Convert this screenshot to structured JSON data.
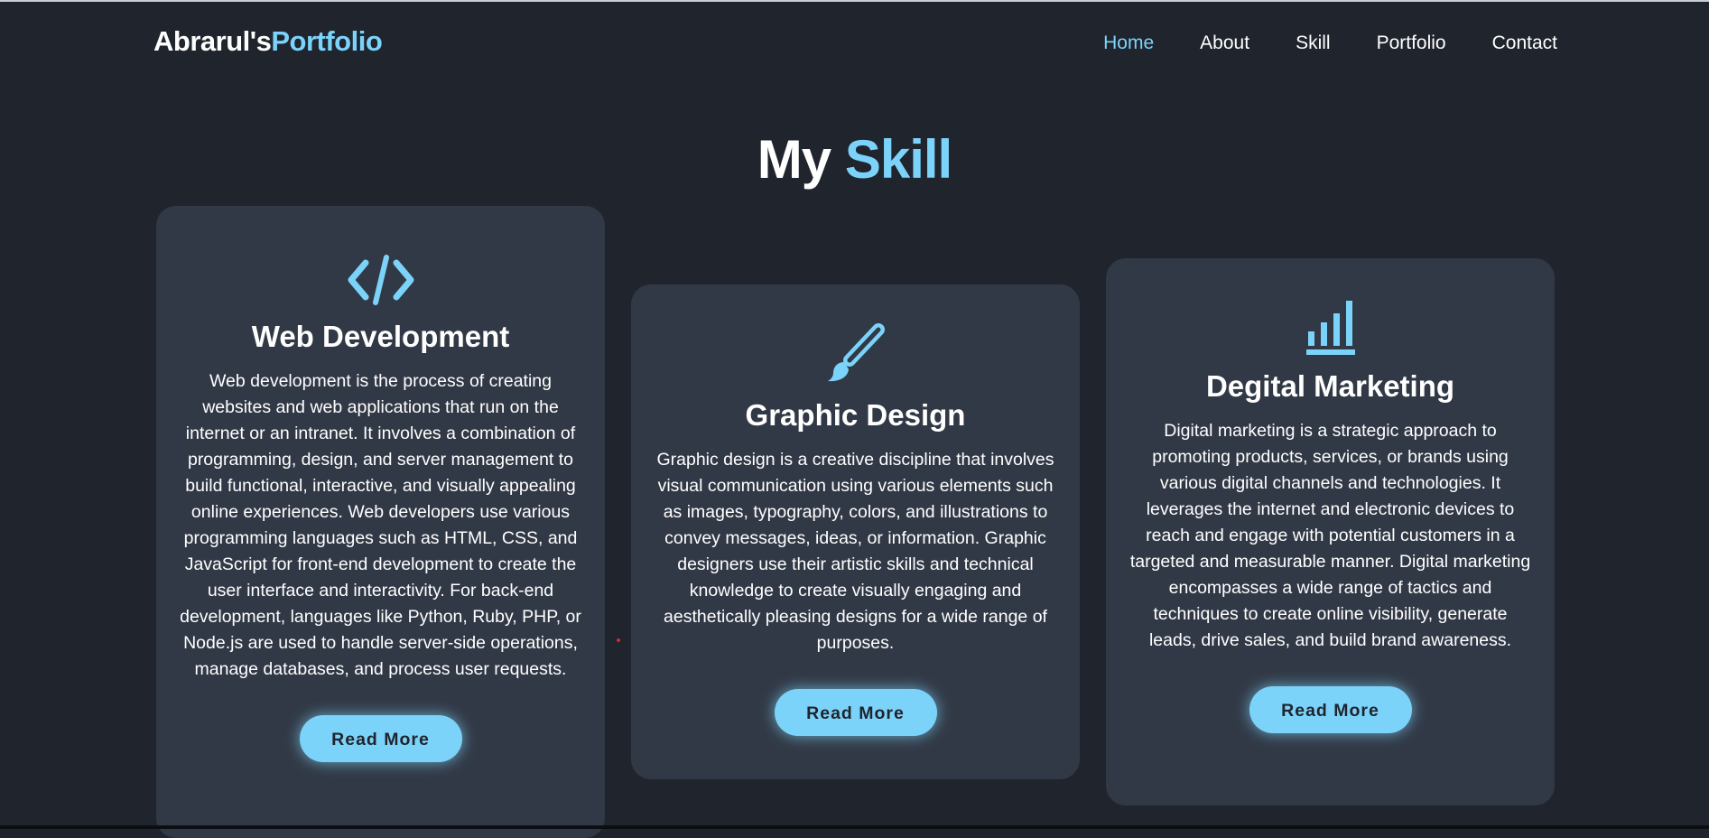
{
  "header": {
    "logo_main": "Abrarul's",
    "logo_accent": "Portfolio",
    "nav": [
      {
        "label": "Home",
        "active": true
      },
      {
        "label": "About",
        "active": false
      },
      {
        "label": "Skill",
        "active": false
      },
      {
        "label": "Portfolio",
        "active": false
      },
      {
        "label": "Contact",
        "active": false
      }
    ]
  },
  "section": {
    "title_main": "My",
    "title_accent": "Skill"
  },
  "cards": [
    {
      "icon": "code-icon",
      "title": "Web Development",
      "description": "Web development is the process of creating websites and web applications that run on the internet or an intranet. It involves a combination of programming, design, and server management to build functional, interactive, and visually appealing online experiences. Web developers use various programming languages such as HTML, CSS, and JavaScript for front-end development to create the user interface and interactivity. For back-end development, languages like Python, Ruby, PHP, or Node.js are used to handle server-side operations, manage databases, and process user requests.",
      "button": "Read More"
    },
    {
      "icon": "paintbrush-icon",
      "title": "Graphic Design",
      "description": "Graphic design is a creative discipline that involves visual communication using various elements such as images, typography, colors, and illustrations to convey messages, ideas, or information. Graphic designers use their artistic skills and technical knowledge to create visually engaging and aesthetically pleasing designs for a wide range of purposes.",
      "button": "Read More"
    },
    {
      "icon": "bar-chart-icon",
      "title": "Degital Marketing",
      "description": "Digital marketing is a strategic approach to promoting products, services, or brands using various digital channels and technologies. It leverages the internet and electronic devices to reach and engage with potential customers in a targeted and measurable manner. Digital marketing encompasses a wide range of tactics and techniques to create online visibility, generate leads, drive sales, and build brand awareness.",
      "button": "Read More"
    }
  ],
  "colors": {
    "background": "#1f242d",
    "card": "#323946",
    "accent": "#7cd3fa",
    "text": "#ffffff"
  }
}
